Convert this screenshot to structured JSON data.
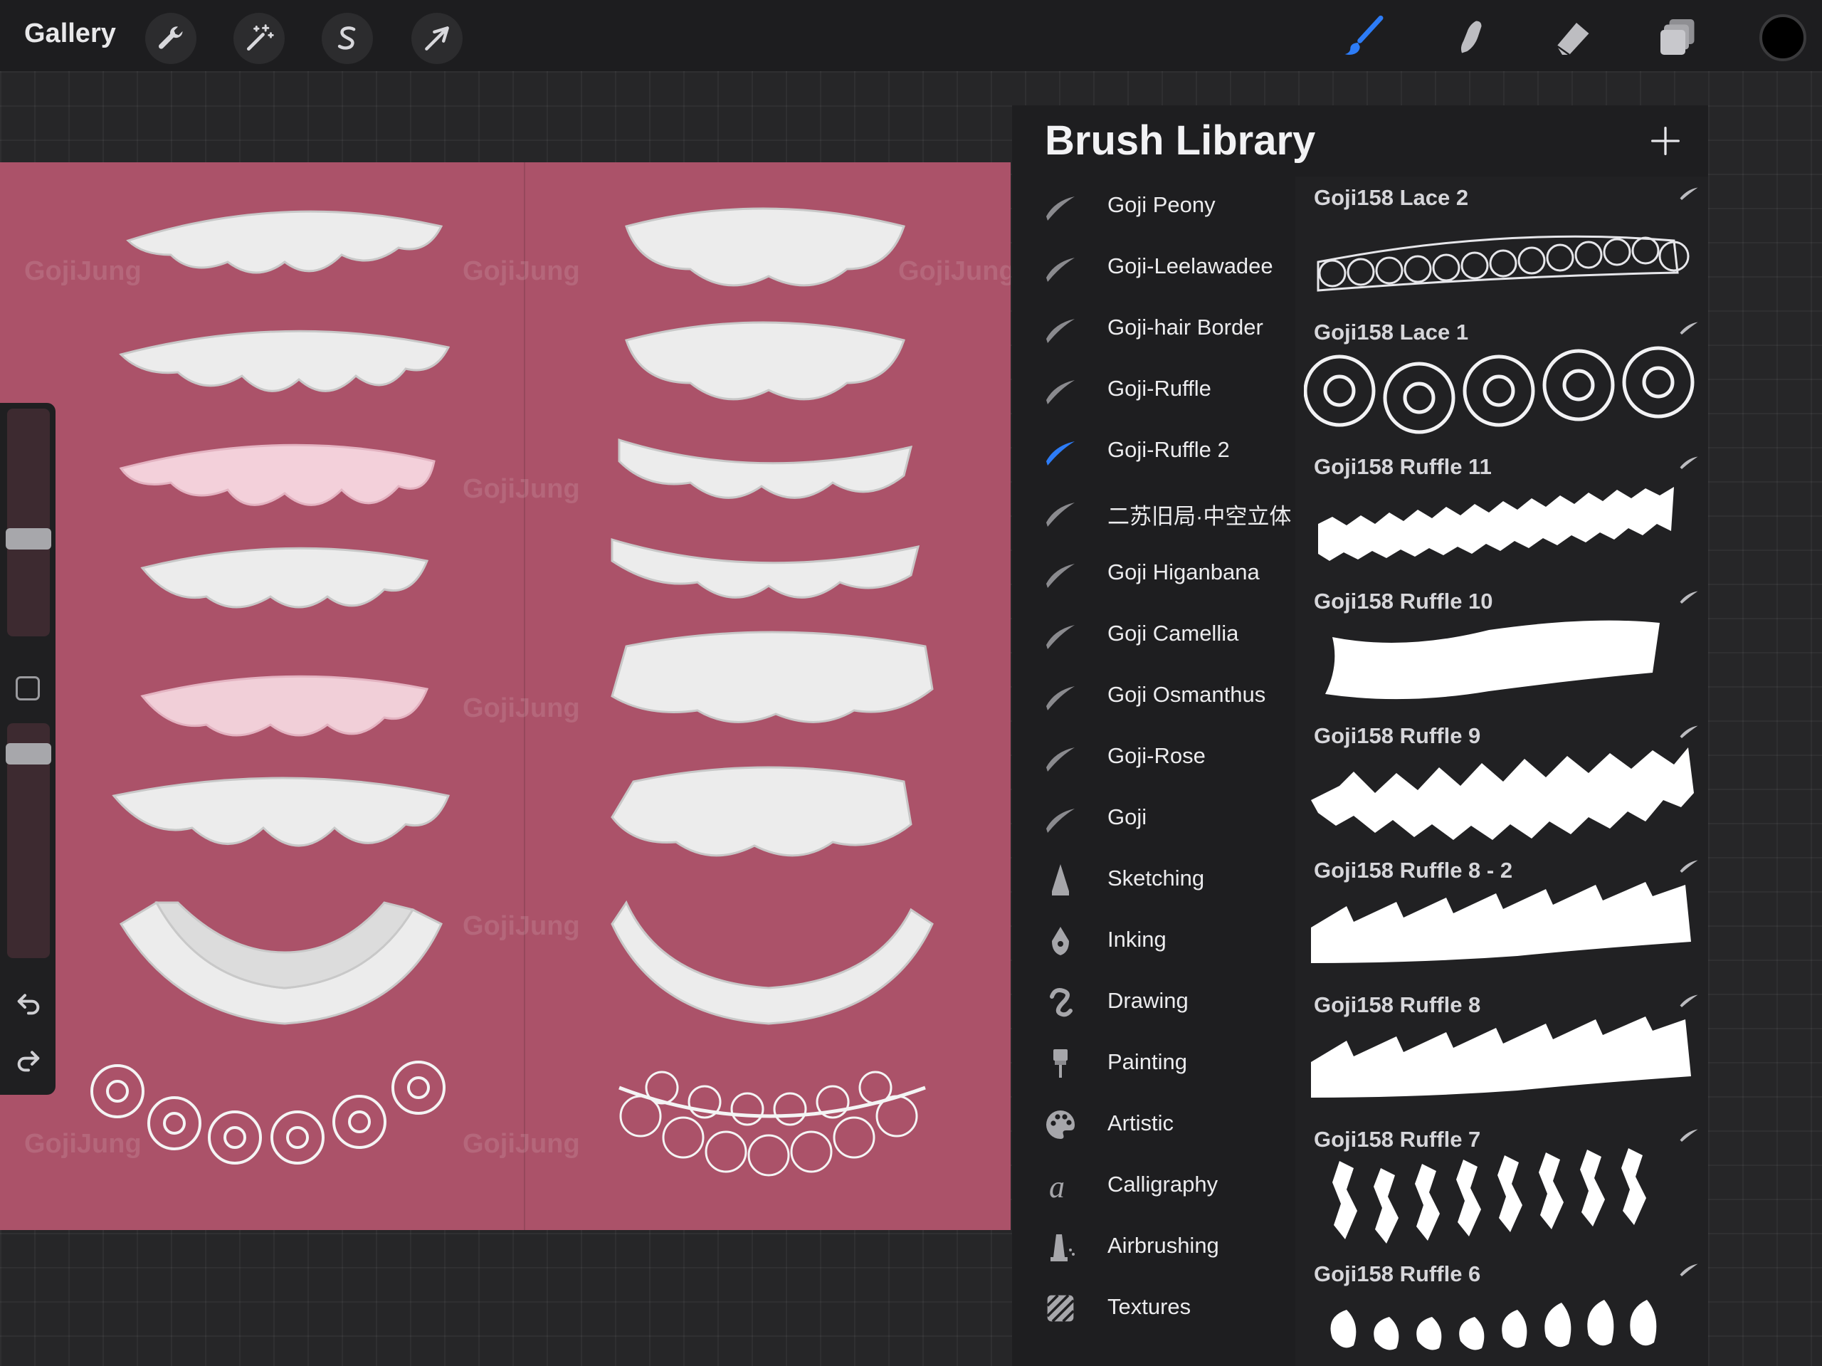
{
  "topbar": {
    "gallery_label": "Gallery",
    "left_icons": [
      "wrench-icon",
      "magic-wand-icon",
      "selection-s-icon",
      "arrow-transform-icon"
    ],
    "right_icons": [
      "brush-icon",
      "smudge-icon",
      "eraser-icon",
      "layers-icon"
    ],
    "accent": "#2d7cf6",
    "current_color": "#000000"
  },
  "canvas": {
    "background": "#ab5269",
    "watermark": "GojiJung"
  },
  "brush_library": {
    "title": "Brush Library",
    "add_label": "+",
    "sets": [
      {
        "label": "Goji Peony",
        "icon": "stroke-icon"
      },
      {
        "label": "Goji-Leelawadee",
        "icon": "stroke-icon"
      },
      {
        "label": "Goji-hair Border",
        "icon": "stroke-icon"
      },
      {
        "label": "Goji-Ruffle",
        "icon": "stroke-icon"
      },
      {
        "label": "Goji-Ruffle 2",
        "icon": "stroke-icon",
        "selected": true
      },
      {
        "label": "二苏旧局·中空立体",
        "icon": "stroke-icon"
      },
      {
        "label": "Goji Higanbana",
        "icon": "stroke-icon"
      },
      {
        "label": "Goji Camellia",
        "icon": "stroke-icon"
      },
      {
        "label": "Goji Osmanthus",
        "icon": "stroke-icon"
      },
      {
        "label": "Goji-Rose",
        "icon": "stroke-icon"
      },
      {
        "label": "Goji",
        "icon": "stroke-icon"
      },
      {
        "label": "Sketching",
        "icon": "pencil-tip-icon"
      },
      {
        "label": "Inking",
        "icon": "pen-nib-icon"
      },
      {
        "label": "Drawing",
        "icon": "squiggle-icon"
      },
      {
        "label": "Painting",
        "icon": "paint-brush-icon"
      },
      {
        "label": "Artistic",
        "icon": "palette-icon"
      },
      {
        "label": "Calligraphy",
        "icon": "calligraphy-a-icon"
      },
      {
        "label": "Airbrushing",
        "icon": "airbrush-icon"
      },
      {
        "label": "Textures",
        "icon": "texture-icon"
      }
    ],
    "brushes": [
      {
        "name": "Goji158 Lace 2",
        "preview": "rose-lace"
      },
      {
        "name": "Goji158 Lace 1",
        "preview": "flower-lace"
      },
      {
        "name": "Goji158 Ruffle 11",
        "preview": "ruffle-strip"
      },
      {
        "name": "Goji158 Ruffle 10",
        "preview": "wave-band"
      },
      {
        "name": "Goji158 Ruffle 9",
        "preview": "zigzag-ruffle"
      },
      {
        "name": "Goji158 Ruffle 8 - 2",
        "preview": "sawtooth"
      },
      {
        "name": "Goji158 Ruffle 8",
        "preview": "sawtooth"
      },
      {
        "name": "Goji158 Ruffle 7",
        "preview": "ribbons"
      },
      {
        "name": "Goji158 Ruffle 6",
        "preview": "leaves"
      }
    ]
  }
}
